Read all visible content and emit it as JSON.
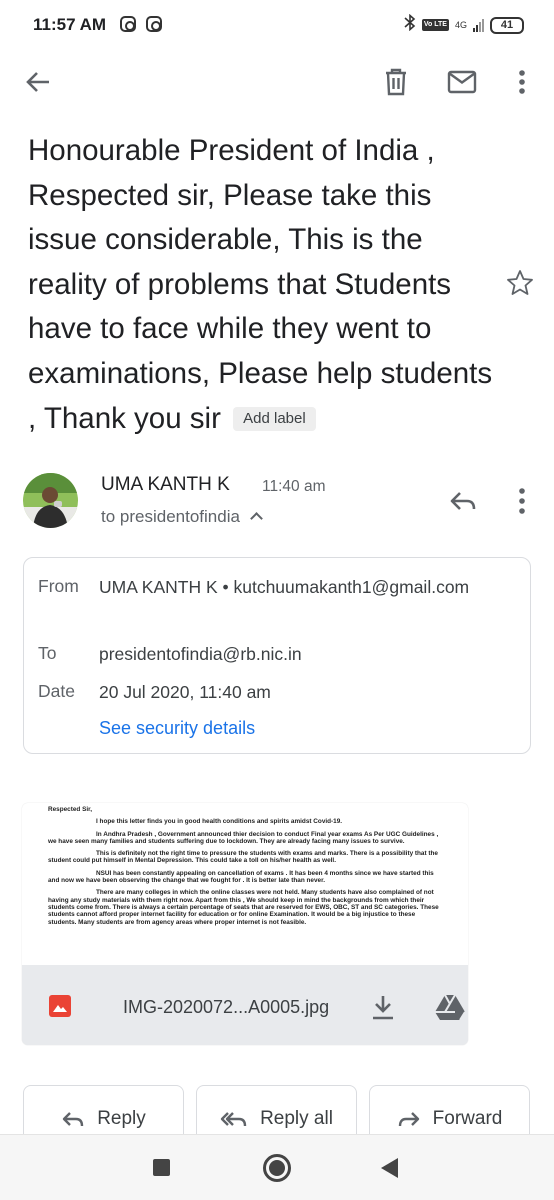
{
  "status_bar": {
    "time": "11:57 AM",
    "network_badge": "Vo LTE",
    "network_type": "4G",
    "battery": "41"
  },
  "toolbar": {
    "back_icon": "arrow-back-icon",
    "delete_icon": "trash-icon",
    "mark_unread_icon": "mail-icon",
    "more_icon": "more-vert-icon"
  },
  "email": {
    "subject": "Honourable President of India , Respected sir, Please take this issue considerable, This is the reality of problems that Students have to face while they went to examinations, Please help students , Thank you sir",
    "add_label": "Add label",
    "sender_name": "UMA KANTH K",
    "time": "11:40 am",
    "to_summary": "to presidentofindia",
    "details": {
      "from_label": "From",
      "from_value": "UMA KANTH K • kutchuumakanth1@gmail.com",
      "to_label": "To",
      "to_value": "presidentofindia@rb.nic.in",
      "date_label": "Date",
      "date_value": "20 Jul 2020, 11:40 am",
      "security_link": "See security details"
    }
  },
  "attachment": {
    "filename": "IMG-2020072...A0005.jpg",
    "preview_paragraphs": [
      "Respected Sir,",
      "I hope this letter finds you in good health conditions and spirits amidst Covid-19.",
      "In Andhra Pradesh , Government announced thier decision to conduct Final year exams As Per UGC Guidelines , we have seen many families and students suffering due to lockdown. They are already facing many issues to survive.",
      "This is definitely not the right time to pressure the students with exams and marks. There is a possibility that the student could put himself in Mental Depression. This could take a toll on his/her health as well.",
      "NSUI has been constantly  appealing on cancellation of exams . It has been 4 months since we have started this and now we have been observing the change that we fought for . It is better late than never.",
      "There are many colleges in which the online classes were not held. Many students have also complained of not having any study materials with them right now. Apart from this , We should keep in mind the backgrounds from which their students come from. There is always a certain percentage of seats that are reserved for EWS, OBC, ST and SC categories. These students cannot afford proper internet facility for education or for online Examination. It would be a big injustice to these students. Many students are from agency areas where proper internet is not feasible."
    ]
  },
  "actions": {
    "reply": "Reply",
    "reply_all": "Reply all",
    "forward": "Forward"
  },
  "colors": {
    "link": "#1a73e8",
    "attachment_icon": "#ea4335"
  }
}
